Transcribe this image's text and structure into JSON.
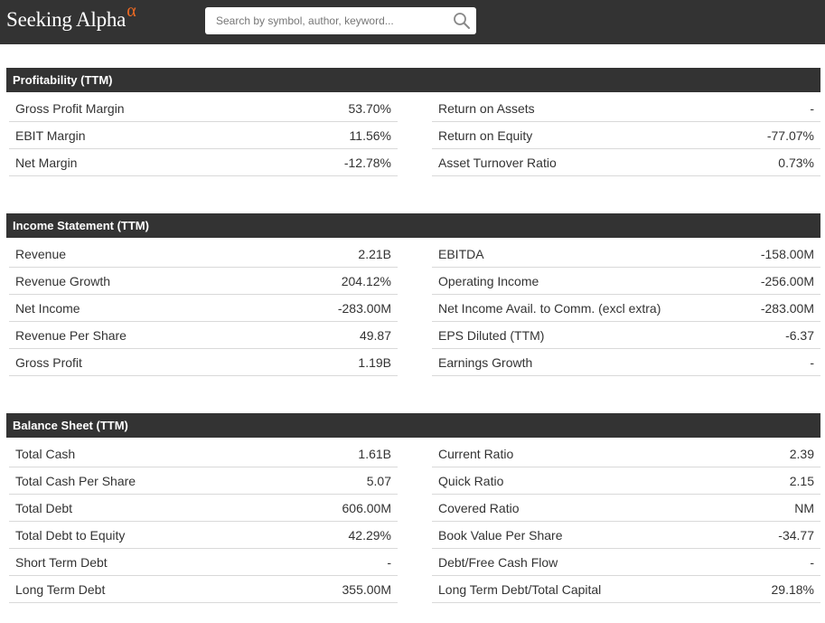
{
  "header": {
    "logo_text": "Seeking Alpha",
    "logo_symbol": "α",
    "search_placeholder": "Search by symbol, author, keyword...",
    "search_icon": "search-icon"
  },
  "colors": {
    "topbar": "#333333",
    "accent": "#f26b22",
    "section_header": "#333333"
  },
  "sections": [
    {
      "title": "Profitability (TTM)",
      "left": [
        {
          "label": "Gross Profit Margin",
          "value": "53.70%"
        },
        {
          "label": "EBIT Margin",
          "value": "11.56%"
        },
        {
          "label": "Net Margin",
          "value": "-12.78%"
        }
      ],
      "right": [
        {
          "label": "Return on Assets",
          "value": "-"
        },
        {
          "label": "Return on Equity",
          "value": "-77.07%"
        },
        {
          "label": "Asset Turnover Ratio",
          "value": "0.73%"
        }
      ]
    },
    {
      "title": "Income Statement (TTM)",
      "left": [
        {
          "label": "Revenue",
          "value": "2.21B"
        },
        {
          "label": "Revenue Growth",
          "value": "204.12%"
        },
        {
          "label": "Net Income",
          "value": "-283.00M"
        },
        {
          "label": "Revenue Per Share",
          "value": "49.87"
        },
        {
          "label": "Gross Profit",
          "value": "1.19B"
        }
      ],
      "right": [
        {
          "label": "EBITDA",
          "value": "-158.00M"
        },
        {
          "label": "Operating Income",
          "value": "-256.00M"
        },
        {
          "label": "Net Income Avail. to Comm. (excl extra)",
          "value": "-283.00M"
        },
        {
          "label": "EPS Diluted (TTM)",
          "value": "-6.37"
        },
        {
          "label": "Earnings Growth",
          "value": "-"
        }
      ]
    },
    {
      "title": "Balance Sheet (TTM)",
      "left": [
        {
          "label": "Total Cash",
          "value": "1.61B"
        },
        {
          "label": "Total Cash Per Share",
          "value": "5.07"
        },
        {
          "label": "Total Debt",
          "value": "606.00M"
        },
        {
          "label": "Total Debt to Equity",
          "value": "42.29%"
        },
        {
          "label": "Short Term Debt",
          "value": "-"
        },
        {
          "label": "Long Term Debt",
          "value": "355.00M"
        }
      ],
      "right": [
        {
          "label": "Current Ratio",
          "value": "2.39"
        },
        {
          "label": "Quick Ratio",
          "value": "2.15"
        },
        {
          "label": "Covered Ratio",
          "value": "NM"
        },
        {
          "label": "Book Value Per Share",
          "value": "-34.77"
        },
        {
          "label": "Debt/Free Cash Flow",
          "value": "-"
        },
        {
          "label": "Long Term Debt/Total Capital",
          "value": "29.18%"
        }
      ]
    }
  ]
}
